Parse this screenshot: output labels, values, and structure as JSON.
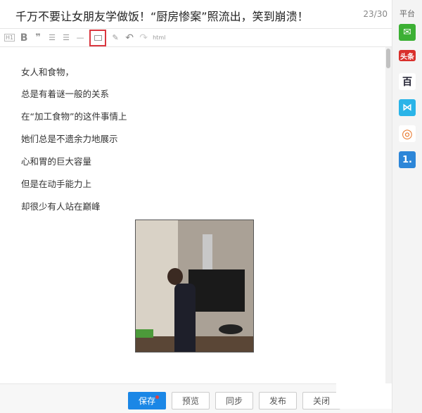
{
  "title": "千万不要让女朋友学做饭！“厨房惨案”照流出，笑到崩溃！",
  "title_count": "23/30",
  "toolbar": {
    "items": [
      {
        "name": "heading-icon",
        "glyph": "H1"
      },
      {
        "name": "bold-icon",
        "glyph": "B"
      },
      {
        "name": "quote-icon",
        "glyph": "❞"
      },
      {
        "name": "ordered-list-icon",
        "glyph": "☰"
      },
      {
        "name": "unordered-list-icon",
        "glyph": "☰"
      },
      {
        "name": "horizontal-rule-icon",
        "glyph": "—"
      },
      {
        "name": "image-icon",
        "glyph": "▨"
      },
      {
        "name": "eraser-icon",
        "glyph": "✎"
      },
      {
        "name": "undo-icon",
        "glyph": "↶"
      },
      {
        "name": "redo-icon",
        "glyph": "↷"
      }
    ],
    "html_label": "html"
  },
  "content": [
    "女人和食物，",
    "总是有着谜一般的关系",
    "在“加工食物”的这件事情上",
    "她们总是不遗余力地展示",
    "心和胃的巨大容量",
    "但是在动手能力上",
    "却很少有人站在巅峰"
  ],
  "sidebar": {
    "header": "平台",
    "platforms": [
      {
        "name": "wechat",
        "label": "✉",
        "color": "#3cb034"
      },
      {
        "name": "toutiao",
        "label": "头条",
        "color": "#d9302c"
      },
      {
        "name": "baijia",
        "label": "百",
        "color": "#ffffff"
      },
      {
        "name": "dayu",
        "label": "⋈",
        "color": "#2ab4e8"
      },
      {
        "name": "sohu",
        "label": "◎",
        "color": "#ffffff"
      },
      {
        "name": "yidian",
        "label": "1.",
        "color": "#2d86d8"
      }
    ]
  },
  "footer": {
    "save": "保存",
    "preview": "预览",
    "sync": "同步",
    "publish": "发布",
    "close": "关闭"
  }
}
